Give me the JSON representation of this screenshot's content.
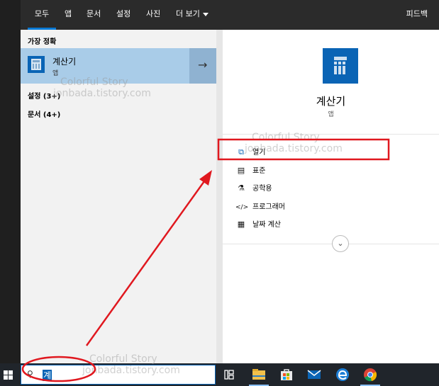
{
  "tabs": [
    {
      "label": "모두"
    },
    {
      "label": "앱"
    },
    {
      "label": "문서"
    },
    {
      "label": "설정"
    },
    {
      "label": "사진"
    },
    {
      "label": "더 보기"
    }
  ],
  "feedback_label": "피드백",
  "results": {
    "section_label": "가장 정확",
    "best_match": {
      "title": "계산기",
      "subtitle": "앱",
      "icon": "calculator-icon"
    },
    "open_arrow_icon": "arrow-right-icon",
    "groups": [
      {
        "label": "설정 (3+)"
      },
      {
        "label": "문서 (4+)"
      }
    ]
  },
  "detail": {
    "title": "계산기",
    "subtitle": "앱",
    "actions": [
      {
        "label": "열기",
        "icon": "open-window-icon"
      },
      {
        "label": "표준",
        "icon": "calculator-icon"
      },
      {
        "label": "공학용",
        "icon": "flask-icon"
      },
      {
        "label": "프로그래머",
        "icon": "code-icon"
      },
      {
        "label": "날짜 계산",
        "icon": "calendar-icon"
      }
    ],
    "expand_icon": "chevron-down-icon"
  },
  "search": {
    "value": "계"
  },
  "taskbar_icons": [
    "windows-start-icon",
    "search-icon",
    "task-view-icon",
    "file-explorer-icon",
    "store-icon",
    "mail-icon",
    "edge-icon",
    "chrome-icon"
  ],
  "watermark": {
    "line1": "Colorful Story",
    "line2": "jonbada.tistory.com"
  },
  "colors": {
    "accent": "#0a64b5",
    "highlight": "#a9cce8",
    "annotation": "#e0181f"
  }
}
